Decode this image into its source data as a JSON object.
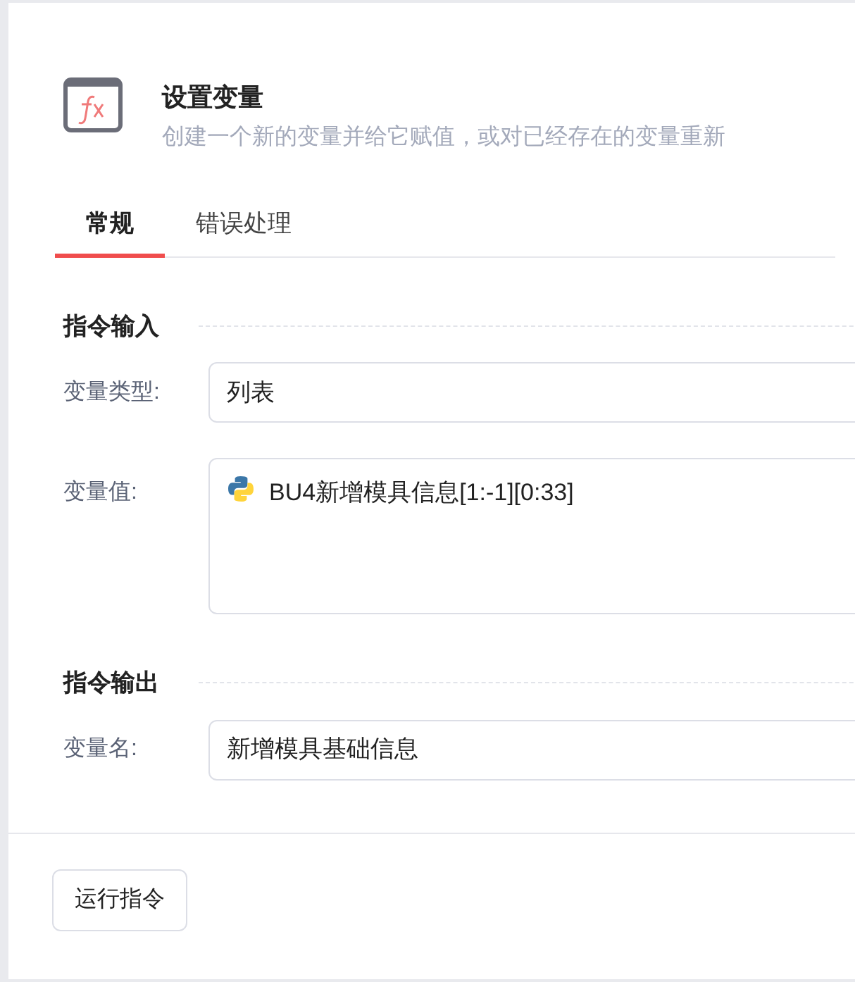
{
  "header": {
    "title": "设置变量",
    "subtitle": "创建一个新的变量并给它赋值，或对已经存在的变量重新"
  },
  "tabs": [
    {
      "label": "常规",
      "selected": true
    },
    {
      "label": "错误处理",
      "selected": false
    }
  ],
  "sections": [
    {
      "title": "指令输入",
      "fields": [
        {
          "label": "变量类型:",
          "value": "列表",
          "kind": "select"
        },
        {
          "label": "变量值:",
          "value": "BU4新增模具信息[1:-1][0:33]",
          "kind": "expression"
        }
      ]
    },
    {
      "title": "指令输出",
      "fields": [
        {
          "label": "变量名:",
          "value": "新增模具基础信息",
          "kind": "text"
        }
      ]
    }
  ],
  "run_button": "运行指令"
}
